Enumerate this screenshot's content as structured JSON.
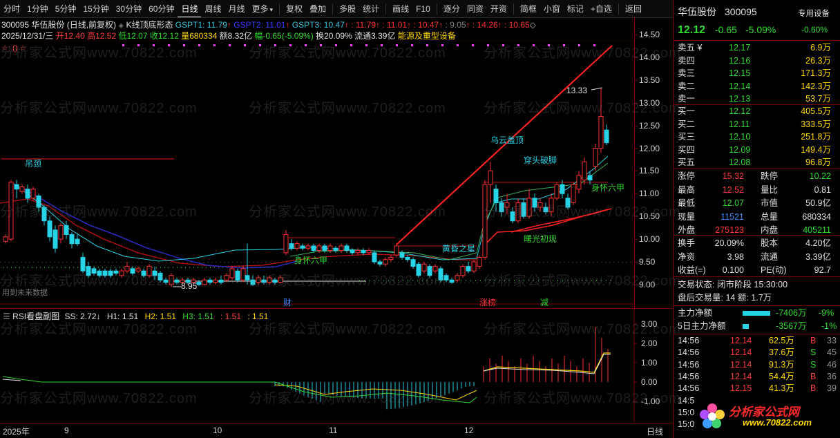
{
  "toolbar": {
    "items": [
      "分时",
      "1分钟",
      "5分钟",
      "15分钟",
      "30分钟",
      "60分钟",
      "日线",
      "周线",
      "月线",
      "更多",
      "复权",
      "叠加",
      "多股",
      "统计",
      "画线",
      "F10",
      "逐分",
      "同资",
      "开资",
      "简框",
      "小窗",
      "标记",
      "+自选",
      "返回"
    ],
    "more_arrow": "▾"
  },
  "info": {
    "code_name": "300095 华伍股份 (日线,前复权)",
    "formula_name": "K线顶底形态",
    "gspt1_label": "GSPT1: 11.79",
    "gspt2_label": "GSPT2: 11.01",
    "gspt3_label": "GSPT3: 10.47",
    "extra_values": [
      ": 11.79",
      ": 11.01",
      ": 10.47",
      ": 9.05",
      ": 14.26",
      ": 10.65"
    ],
    "date_line": "2025/12/31/三",
    "open": "开12.40",
    "high": "高12.52",
    "low": "低12.07",
    "close": "收12.12",
    "volume": "量680334",
    "amount": "额8.32亿",
    "change": "幅-0.65(-5.09%)",
    "turnover": "换20.09%",
    "float": "流通3.39亿",
    "sector": "能源及重型设备",
    "star_marker": "☆: () ☆",
    "future_data": "用到未来数据"
  },
  "price_axis": [
    "14.50",
    "14.00",
    "13.50",
    "13.00",
    "12.50",
    "12.00",
    "11.50",
    "11.00",
    "10.50",
    "10.00",
    "9.50",
    "9.00"
  ],
  "sub_axis": [
    "3.00",
    "2.00",
    "1.00",
    "0.00",
    "-1.00"
  ],
  "x_axis": [
    "2025年",
    "9",
    "10",
    "11",
    "12",
    "日线"
  ],
  "annotations": {
    "diaojing": "吊颈",
    "shenbei1": "身怀六甲",
    "huanghun": "黄昏之星",
    "wuyun": "乌云盖顶",
    "chuantou": "穿头破脚",
    "shuguang": "曙光初现",
    "shenbei2": "身怀六甲",
    "high_mark": "13.33",
    "low_mark": "8.95",
    "cai": "财",
    "zhangbang": "涨榜",
    "jian": "减"
  },
  "sub_title": {
    "name": "RSI看盘副图",
    "ss": "SS: 2.72↓",
    "h1": "H1: 1.51",
    "h2": "H2: 1.51",
    "h3": "H3: 1.51",
    "v4": ": 1.51",
    "v5": ": 1.51"
  },
  "watermark": "分析家公式网www.70822.com",
  "logo": {
    "name": "分析家公式网",
    "url": "www.70822.com"
  },
  "right_panel": {
    "stock_name": "华伍股份",
    "stock_code": "300095",
    "badge_top": "专用设备",
    "badge_pct": "-0.60%",
    "price": "12.12",
    "change": "-0.65",
    "pct": "-5.09%",
    "asks": [
      {
        "label": "卖五 ¥",
        "price": "12.17",
        "vol": "6.9万"
      },
      {
        "label": "卖四",
        "price": "12.16",
        "vol": "26.3万"
      },
      {
        "label": "卖三",
        "price": "12.15",
        "vol": "171.3万"
      },
      {
        "label": "卖二",
        "price": "12.14",
        "vol": "142.3万"
      },
      {
        "label": "卖一",
        "price": "12.13",
        "vol": "53.7万"
      }
    ],
    "bids": [
      {
        "label": "买一",
        "price": "12.12",
        "vol": "405.5万"
      },
      {
        "label": "买二",
        "price": "12.11",
        "vol": "333.5万"
      },
      {
        "label": "买三",
        "price": "12.10",
        "vol": "251.8万"
      },
      {
        "label": "买四",
        "price": "12.09",
        "vol": "149.4万"
      },
      {
        "label": "买五",
        "price": "12.08",
        "vol": "96.8万"
      }
    ],
    "stats1": [
      {
        "l1": "涨停",
        "v1": "15.32",
        "l2": "跌停",
        "v2": "10.22"
      },
      {
        "l1": "最高",
        "v1": "12.52",
        "l2": "量比",
        "v2": "0.81"
      },
      {
        "l1": "最低",
        "v1": "12.07",
        "l2": "市值",
        "v2": "50.9亿"
      },
      {
        "l1": "现量",
        "v1": "11521",
        "l2": "总量",
        "v2": "680334"
      },
      {
        "l1": "外盘",
        "v1": "275123",
        "l2": "内盘",
        "v2": "405211"
      }
    ],
    "stats2": [
      {
        "l1": "换手",
        "v1": "20.09%",
        "l2": "股本",
        "v2": "4.20亿"
      },
      {
        "l1": "净资",
        "v1": "3.98",
        "l2": "流通",
        "v2": "3.39亿"
      },
      {
        "l1": "收益(=)",
        "v1": "0.100",
        "l2": "PE(动)",
        "v2": "92.7"
      }
    ],
    "trade_status": "交易状态: 闭市阶段 15:30:00",
    "after_trade": "盘后交易量: 14  额: 1.7万",
    "flow1": {
      "label": "主力净额",
      "value": "-7406万",
      "pct": "-9%"
    },
    "flow2": {
      "label": "5日主力净额",
      "value": "-3567万",
      "pct": "-1%"
    },
    "ticks": [
      {
        "time": "14:56",
        "price": "12.14",
        "vol": "62.5万",
        "bs": "B",
        "n": "33"
      },
      {
        "time": "14:56",
        "price": "12.14",
        "vol": "37.6万",
        "bs": "S",
        "n": "45"
      },
      {
        "time": "14:56",
        "price": "12.14",
        "vol": "91.3万",
        "bs": "S",
        "n": "46"
      },
      {
        "time": "14:56",
        "price": "12.14",
        "vol": "54.4万",
        "bs": "B",
        "n": "36"
      },
      {
        "time": "14:56",
        "price": "12.15",
        "vol": "41.3万",
        "bs": "B",
        "n": "39"
      },
      {
        "time": "14:5",
        "price": "",
        "vol": "",
        "bs": "",
        "n": ""
      },
      {
        "time": "15:0",
        "price": "",
        "vol": "",
        "bs": "",
        "n": ""
      },
      {
        "time": "15:0",
        "price": "",
        "vol": "",
        "bs": "",
        "n": ""
      }
    ]
  }
}
